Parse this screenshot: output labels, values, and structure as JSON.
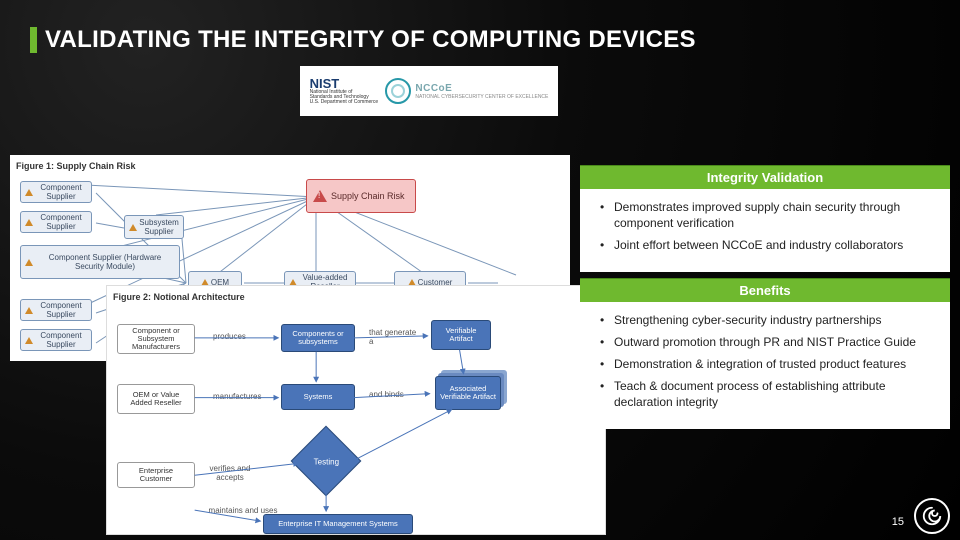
{
  "title": "VALIDATING THE INTEGRITY OF COMPUTING DEVICES",
  "logos": {
    "nist": "NIST",
    "nist_sub1": "National Institute of",
    "nist_sub2": "Standards and Technology",
    "nist_sub3": "U.S. Department of Commerce",
    "nccoe": "NCCoE",
    "nccoe_sub": "NATIONAL CYBERSECURITY CENTER OF EXCELLENCE"
  },
  "figure1": {
    "caption": "Figure 1: Supply Chain Risk",
    "risk_label": "Supply Chain Risk",
    "nodes": {
      "cs1": "Component Supplier",
      "cs2": "Component Supplier",
      "cs3": "Component Supplier",
      "cs4": "Component Supplier",
      "sub": "Subsystem Supplier",
      "hsm": "Component Supplier (Hardware Security Module)",
      "oem": "OEM",
      "var": "Value-added Reseller",
      "cust": "Customer"
    }
  },
  "figure2": {
    "caption": "Figure 2: Notional Architecture",
    "nodes": {
      "mfr": "Component or Subsystem Manufacturers",
      "oemvar": "OEM or Value Added Reseller",
      "ent": "Enterprise Customer",
      "comp": "Components or subsystems",
      "sys": "Systems",
      "va": "Verifiable Artifact",
      "ava": "Associated Verifiable Artifact",
      "test": "Testing",
      "eit": "Enterprise IT Management Systems"
    },
    "labels": {
      "produces": "produces",
      "that_gen": "that generate a",
      "manufactures": "manufactures",
      "and_binds": "and binds",
      "verifies": "verifies and accepts",
      "maintains": "maintains and uses"
    }
  },
  "panel1": {
    "heading": "Integrity Validation",
    "items": [
      "Demonstrates improved supply chain security through component verification",
      "Joint effort between NCCoE and industry collaborators"
    ]
  },
  "panel2": {
    "heading": "Benefits",
    "items": [
      "Strengthening cyber-security industry partnerships",
      "Outward promotion through PR and NIST Practice Guide",
      "Demonstration & integration of trusted product features",
      "Teach & document process of establishing attribute declaration integrity"
    ]
  },
  "page_number": "15"
}
